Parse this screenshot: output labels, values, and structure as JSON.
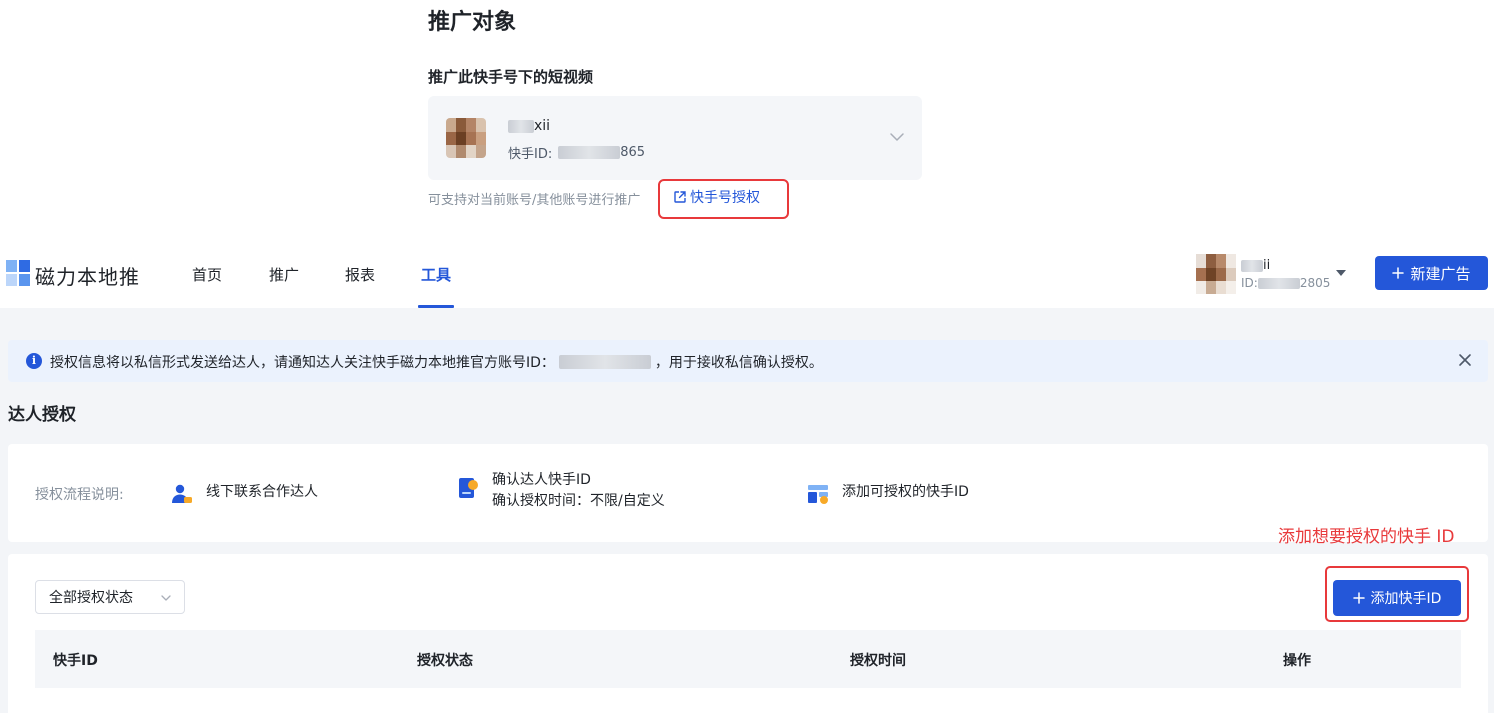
{
  "promotion": {
    "title": "推广对象",
    "subtitle": "推广此快手号下的短视频",
    "account": {
      "name_suffix": "xii",
      "id_label": "快手ID:",
      "id_suffix": "865"
    },
    "support_text": "可支持对当前账号/其他账号进行推广",
    "auth_link": "快手号授权"
  },
  "header": {
    "logo_text": "磁力本地推",
    "nav": [
      {
        "label": "首页"
      },
      {
        "label": "推广"
      },
      {
        "label": "报表"
      },
      {
        "label": "工具"
      }
    ],
    "active_nav": "工具",
    "user": {
      "name_suffix": "ii",
      "id_prefix": "ID:",
      "id_suffix": "2805"
    },
    "new_ad_button": "新建广告"
  },
  "notice": {
    "text_before": "授权信息将以私信形式发送给达人，请通知达人关注快手磁力本地推官方账号ID：",
    "text_after": "，用于接收私信确认授权。"
  },
  "section_title": "达人授权",
  "flow": {
    "label": "授权流程说明:",
    "steps": [
      {
        "line1": "线下联系合作达人",
        "icon": "user-contact-icon"
      },
      {
        "line1": "确认达人快手ID",
        "line2": "确认授权时间：不限/自定义",
        "icon": "id-card-icon"
      },
      {
        "line1": "添加可授权的快手ID",
        "icon": "grid-add-icon"
      }
    ]
  },
  "annotation": "添加想要授权的快手 ID",
  "list": {
    "status_filter": "全部授权状态",
    "add_button": "添加快手ID",
    "columns": [
      "快手ID",
      "授权状态",
      "授权时间",
      "操作"
    ]
  },
  "colors": {
    "primary": "#2457d9",
    "annotation_red": "#e8393b",
    "notice_bg": "#ebf2fd",
    "page_bg": "#f3f5f8"
  }
}
